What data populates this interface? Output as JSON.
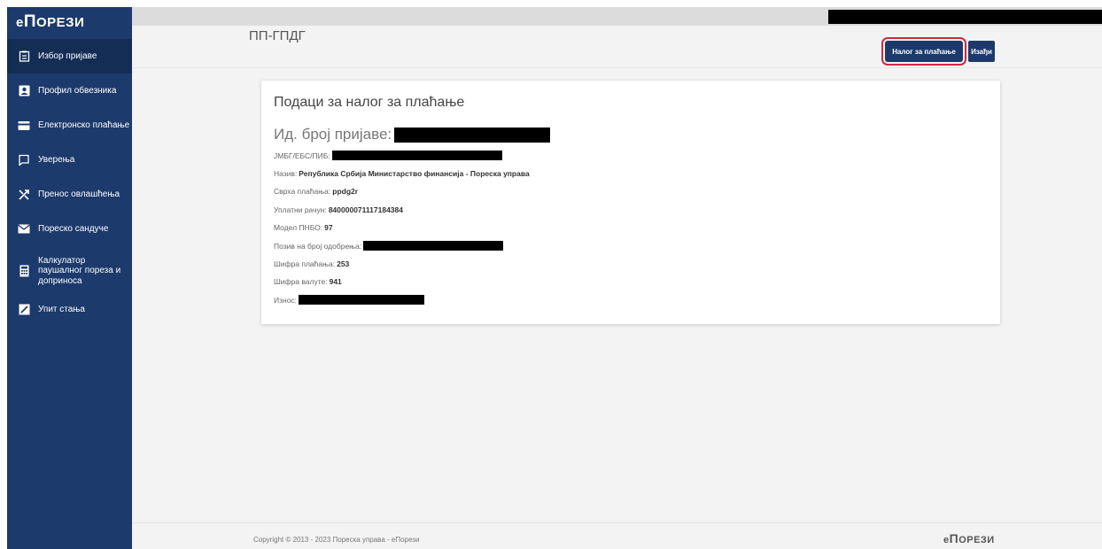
{
  "brand": {
    "prefix": "е",
    "main": "П",
    "rest": "ОРЕЗИ"
  },
  "sidebar": {
    "items": [
      {
        "label": "Избор пријаве",
        "icon": "clipboard-list-icon"
      },
      {
        "label": "Профил обвезника",
        "icon": "user-card-icon"
      },
      {
        "label": "Електронско плаћање",
        "icon": "credit-card-icon"
      },
      {
        "label": "Уверења",
        "icon": "certificate-icon"
      },
      {
        "label": "Пренос овлашћења",
        "icon": "transfer-icon"
      },
      {
        "label": "Пореско сандуче",
        "icon": "envelope-icon"
      },
      {
        "label": "Калкулатор паушалног пореза и доприноса",
        "icon": "calculator-icon"
      },
      {
        "label": "Упит стања",
        "icon": "edit-check-icon"
      }
    ]
  },
  "header": {
    "title": "ПП-ГПДГ",
    "pay_button": "Налог за плаћање",
    "exit_button": "Изађи"
  },
  "card": {
    "title": "Подаци за налог за плаћање",
    "id_label": "Ид. број пријаве:",
    "fields": [
      {
        "label": "ЈМБГ/ЕБС/ПИБ:",
        "value": ""
      },
      {
        "label": "Назив:",
        "value": "Република Србија Министарство финансија - Пореска управа"
      },
      {
        "label": "Сврха плаћања:",
        "value": "ppdg2r"
      },
      {
        "label": "Уплатни рачун:",
        "value": "840000071117184384"
      },
      {
        "label": "Модел ПНБО:",
        "value": "97"
      },
      {
        "label": "Позив на број одобрења:",
        "value": ""
      },
      {
        "label": "Шифра плаћања:",
        "value": "253"
      },
      {
        "label": "Шифра валуте:",
        "value": "941"
      },
      {
        "label": "Износ:",
        "value": ""
      }
    ]
  },
  "footer": {
    "copyright": "Copyright © 2013 - 2023 Пореска управа - еПорези"
  }
}
